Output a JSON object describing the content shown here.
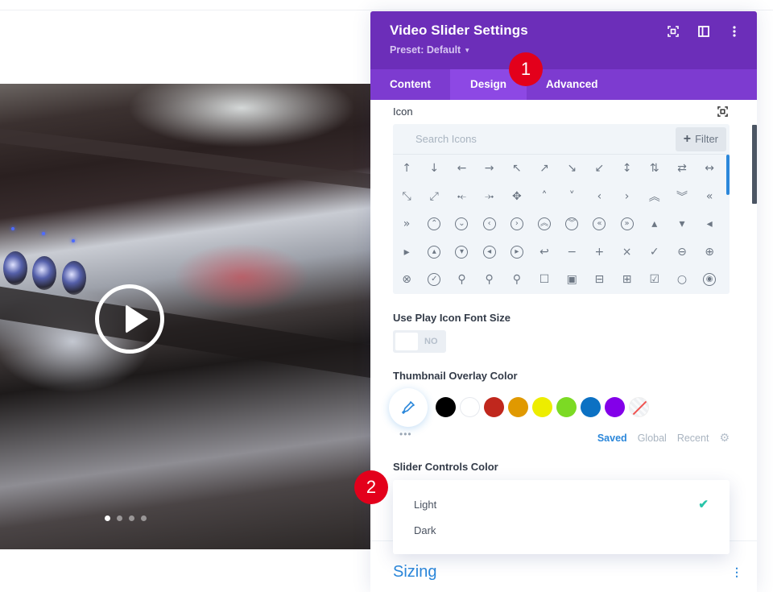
{
  "panel": {
    "title": "Video Slider Settings",
    "preset_label": "Preset: Default",
    "header_icons": [
      "focus-mode-icon",
      "split-view-icon",
      "more-options-icon"
    ],
    "tabs": [
      {
        "label": "Content",
        "active": false
      },
      {
        "label": "Design",
        "active": true
      },
      {
        "label": "Advanced",
        "active": false
      }
    ]
  },
  "icon_field": {
    "label": "Icon",
    "search_placeholder": "Search Icons",
    "filter_label": "Filter",
    "icons": [
      {
        "name": "arrow-up",
        "glyph": "↑"
      },
      {
        "name": "arrow-down",
        "glyph": "↓"
      },
      {
        "name": "arrow-left",
        "glyph": "←"
      },
      {
        "name": "arrow-right",
        "glyph": "→"
      },
      {
        "name": "arrow-up-left",
        "glyph": "↖"
      },
      {
        "name": "arrow-up-right",
        "glyph": "↗"
      },
      {
        "name": "arrow-down-right",
        "glyph": "↘"
      },
      {
        "name": "arrow-down-left",
        "glyph": "↙"
      },
      {
        "name": "arrow-up-down",
        "glyph": "↕"
      },
      {
        "name": "arrows-vertical",
        "glyph": "⇅"
      },
      {
        "name": "arrows-horizontal",
        "glyph": "⇄"
      },
      {
        "name": "arrow-left-right",
        "glyph": "↔"
      },
      {
        "name": "resize-diagonal",
        "glyph": "⤡"
      },
      {
        "name": "resize-diagonal-alt",
        "glyph": "⤢"
      },
      {
        "name": "shrink",
        "glyph": "⤝"
      },
      {
        "name": "expand",
        "glyph": "⤞"
      },
      {
        "name": "move",
        "glyph": "✥"
      },
      {
        "name": "chevron-up",
        "glyph": "˄"
      },
      {
        "name": "chevron-down",
        "glyph": "˅"
      },
      {
        "name": "chevron-left",
        "glyph": "‹"
      },
      {
        "name": "chevron-right",
        "glyph": "›"
      },
      {
        "name": "double-chevron-up",
        "glyph": "︽"
      },
      {
        "name": "double-chevron-down",
        "glyph": "︾"
      },
      {
        "name": "double-chevron-left",
        "glyph": "«"
      },
      {
        "name": "double-chevron-right",
        "glyph": "»"
      },
      {
        "name": "circle-chevron-up",
        "glyph": "⌃"
      },
      {
        "name": "circle-chevron-down",
        "glyph": "⌄"
      },
      {
        "name": "circle-chevron-left",
        "glyph": "‹"
      },
      {
        "name": "circle-chevron-right",
        "glyph": "›"
      },
      {
        "name": "circle-double-up",
        "glyph": "︽"
      },
      {
        "name": "circle-double-down",
        "glyph": "︾"
      },
      {
        "name": "circle-double-left",
        "glyph": "«"
      },
      {
        "name": "circle-double-right",
        "glyph": "»"
      },
      {
        "name": "caret-up",
        "glyph": "▴"
      },
      {
        "name": "caret-down",
        "glyph": "▾"
      },
      {
        "name": "caret-left",
        "glyph": "◂"
      },
      {
        "name": "caret-right",
        "glyph": "▸"
      },
      {
        "name": "circle-caret-up",
        "glyph": "▴"
      },
      {
        "name": "circle-caret-down",
        "glyph": "▾"
      },
      {
        "name": "circle-caret-left",
        "glyph": "◂"
      },
      {
        "name": "circle-caret-right",
        "glyph": "▸"
      },
      {
        "name": "undo",
        "glyph": "↩"
      },
      {
        "name": "minus",
        "glyph": "−"
      },
      {
        "name": "plus",
        "glyph": "+"
      },
      {
        "name": "close",
        "glyph": "×"
      },
      {
        "name": "check",
        "glyph": "✓"
      },
      {
        "name": "circle-minus",
        "glyph": "⊖"
      },
      {
        "name": "circle-plus",
        "glyph": "⊕"
      },
      {
        "name": "circle-close",
        "glyph": "⊗"
      },
      {
        "name": "circle-check",
        "glyph": "✓"
      },
      {
        "name": "zoom-out",
        "glyph": "⚲"
      },
      {
        "name": "zoom-in",
        "glyph": "⚲"
      },
      {
        "name": "search",
        "glyph": "⚲"
      },
      {
        "name": "square",
        "glyph": "☐"
      },
      {
        "name": "square-filled",
        "glyph": "▣"
      },
      {
        "name": "square-minus",
        "glyph": "⊟"
      },
      {
        "name": "square-plus",
        "glyph": "⊞"
      },
      {
        "name": "checkbox-checked",
        "glyph": "☑"
      },
      {
        "name": "circle",
        "glyph": "○"
      },
      {
        "name": "radio-checked",
        "glyph": "◉"
      }
    ]
  },
  "play_icon_font_size": {
    "label": "Use Play Icon Font Size",
    "value": "NO"
  },
  "thumbnail_overlay": {
    "label": "Thumbnail Overlay Color",
    "swatches": [
      {
        "name": "black",
        "color": "#000000"
      },
      {
        "name": "white",
        "color": "#ffffff"
      },
      {
        "name": "red",
        "color": "#c0271d"
      },
      {
        "name": "orange",
        "color": "#e09900"
      },
      {
        "name": "yellow",
        "color": "#eded00"
      },
      {
        "name": "green",
        "color": "#7cda24"
      },
      {
        "name": "blue",
        "color": "#0c71c3"
      },
      {
        "name": "purple",
        "color": "#8300e9"
      },
      {
        "name": "none",
        "color": "transparent"
      }
    ],
    "palette_tabs": [
      {
        "label": "Saved",
        "active": true
      },
      {
        "label": "Global",
        "active": false
      },
      {
        "label": "Recent",
        "active": false
      }
    ],
    "more_label": "•••"
  },
  "slider_controls": {
    "label": "Slider Controls Color",
    "options": [
      {
        "label": "Light",
        "selected": true
      },
      {
        "label": "Dark",
        "selected": false
      }
    ]
  },
  "sizing_section": {
    "title": "Sizing",
    "menu": "⋮"
  },
  "slider": {
    "dot_count": 4,
    "active_dot": 0
  },
  "annotations": {
    "badge_1": "1",
    "badge_2": "2"
  },
  "colors": {
    "header": "#6c2eb9",
    "tabs": "#7d3bd0",
    "tab_active": "#8d48e4",
    "accent_blue": "#2b87da",
    "check_green": "#29c4a9",
    "badge_red": "#e3001b"
  }
}
